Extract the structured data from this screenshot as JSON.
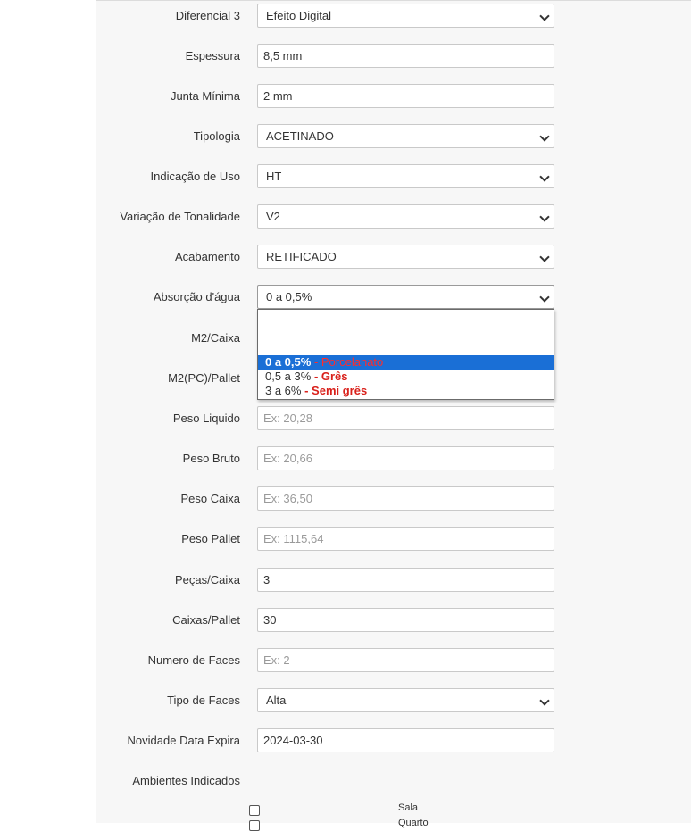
{
  "form": {
    "diferencial3": {
      "label": "Diferencial 3",
      "value": "Efeito Digital"
    },
    "espessura": {
      "label": "Espessura",
      "value": "8,5 mm"
    },
    "junta_minima": {
      "label": "Junta Mínima",
      "value": "2 mm"
    },
    "tipologia": {
      "label": "Tipologia",
      "value": "ACETINADO"
    },
    "indicacao_uso": {
      "label": "Indicação de Uso",
      "value": "HT"
    },
    "variacao_tonalidade": {
      "label": "Variação de Tonalidade",
      "value": "V2"
    },
    "acabamento": {
      "label": "Acabamento",
      "value": "RETIFICADO"
    },
    "absorcao_agua": {
      "label": "Absorção d'água",
      "value": "0 a 0,5%",
      "options": [
        {
          "main": "",
          "tag": ""
        },
        {
          "main": "0 a 0,5%",
          "tag": " - Porcelanato",
          "selected": true
        },
        {
          "main": "0,5 a 3%",
          "tag": " - Grês"
        },
        {
          "main": "3 a 6%",
          "tag": " - Semi grês"
        }
      ]
    },
    "m2_caixa": {
      "label": "M2/Caixa"
    },
    "m2_pc_pallet": {
      "label": "M2(PC)/Pallet"
    },
    "peso_liquido": {
      "label": "Peso Liquido",
      "placeholder": "Ex: 20,28"
    },
    "peso_bruto": {
      "label": "Peso Bruto",
      "placeholder": "Ex: 20,66"
    },
    "peso_caixa": {
      "label": "Peso Caixa",
      "placeholder": "Ex: 36,50"
    },
    "peso_pallet": {
      "label": "Peso Pallet",
      "placeholder": "Ex: 1115,64"
    },
    "pecas_caixa": {
      "label": "Peças/Caixa",
      "value": "3"
    },
    "caixas_pallet": {
      "label": "Caixas/Pallet",
      "value": "30"
    },
    "numero_faces": {
      "label": "Numero de Faces",
      "placeholder": "Ex: 2"
    },
    "tipo_faces": {
      "label": "Tipo de Faces",
      "value": "Alta"
    },
    "novidade_data_expira": {
      "label": "Novidade Data Expira",
      "value": "2024-03-30"
    },
    "ambientes": {
      "label": "Ambientes Indicados",
      "items": [
        "Sala",
        "Quarto"
      ]
    }
  }
}
